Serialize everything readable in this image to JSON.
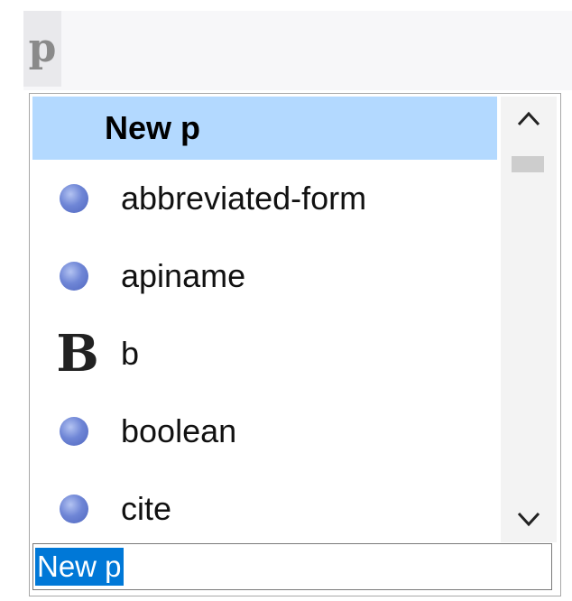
{
  "editor": {
    "element_tag": "p"
  },
  "popup": {
    "header": "New p",
    "items": [
      {
        "label": "abbreviated-form",
        "icon": "element-dot-icon"
      },
      {
        "label": "apiname",
        "icon": "element-dot-icon"
      },
      {
        "label": "b",
        "icon": "bold-icon"
      },
      {
        "label": "boolean",
        "icon": "element-dot-icon"
      },
      {
        "label": "cite",
        "icon": "element-dot-icon"
      }
    ],
    "input_value": "New p"
  },
  "colors": {
    "header_bg": "#b3d9ff",
    "selection_bg": "#0078d7",
    "dot_icon": "#6f86d6"
  }
}
